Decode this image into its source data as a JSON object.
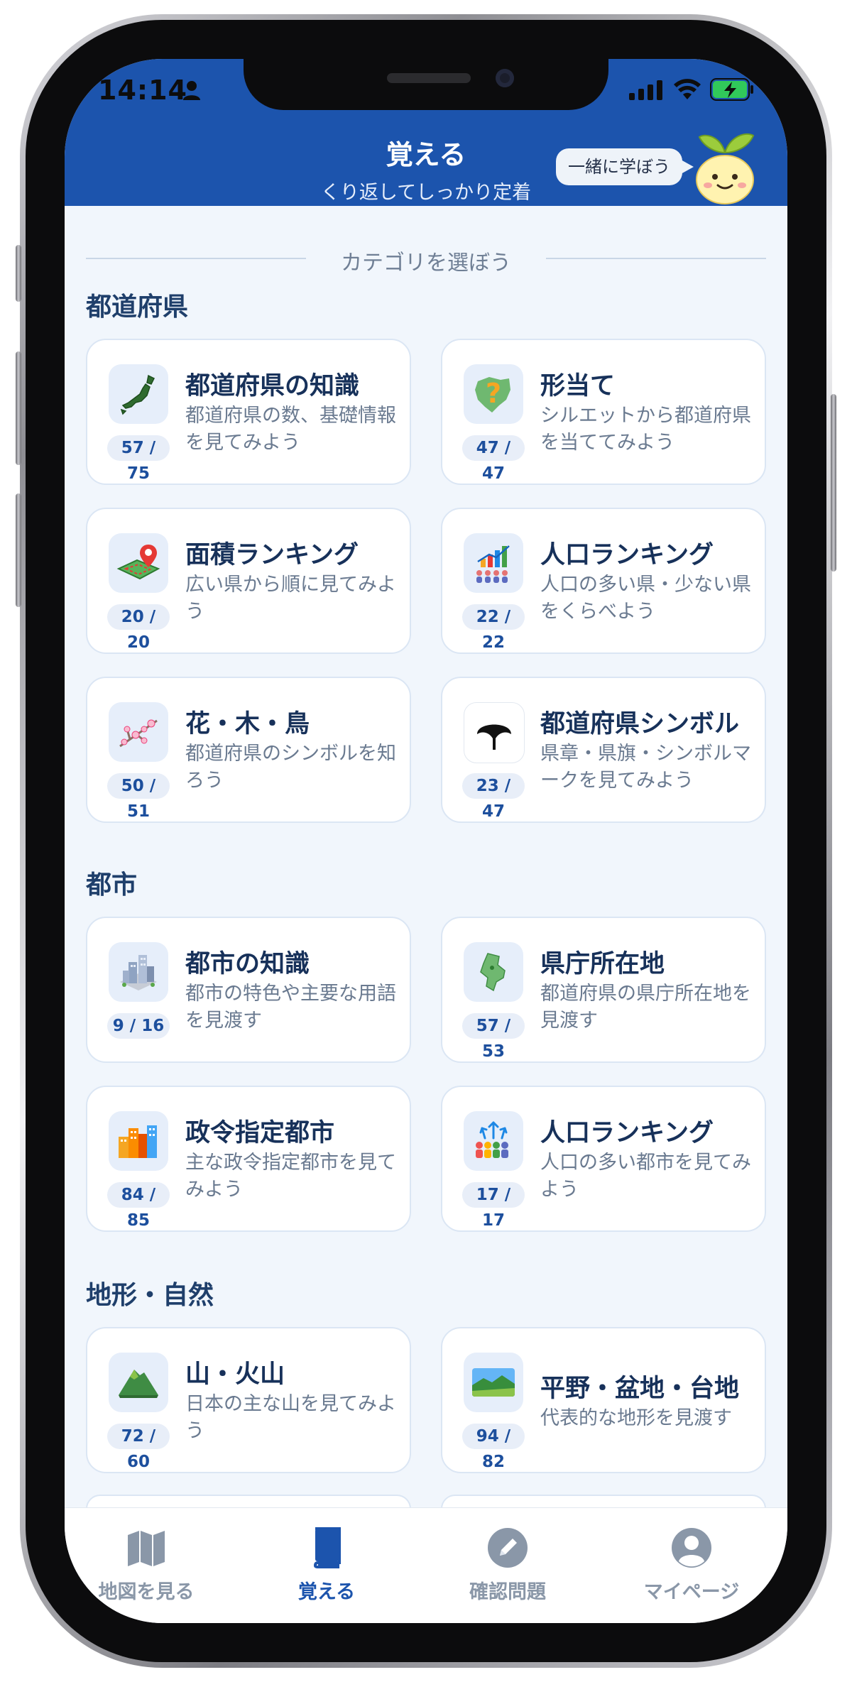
{
  "status_bar": {
    "time": "14:14"
  },
  "header": {
    "title": "覚える",
    "subtitle": "くり返してしっかり定着",
    "bubble": "一緒に学ぼう"
  },
  "divider": "カテゴリを選ぼう",
  "sections": [
    {
      "title": "都道府県"
    },
    {
      "title": "都市"
    },
    {
      "title": "地形・自然"
    }
  ],
  "cards": [
    {
      "title": "都道府県の知識",
      "desc": "都道府県の数、基礎情報を見てみよう",
      "count": "57 / 75",
      "icon": "japan-map-icon"
    },
    {
      "title": "形当て",
      "desc": "シルエットから都道府県を当ててみよう",
      "count": "47 / 47",
      "icon": "silhouette-question-icon"
    },
    {
      "title": "面積ランキング",
      "desc": "広い県から順に見てみよう",
      "count": "20 / 20",
      "icon": "area-pin-map-icon"
    },
    {
      "title": "人口ランキング",
      "desc": "人口の多い県・少ない県をくらべよう",
      "count": "22 / 22",
      "icon": "population-chart-icon"
    },
    {
      "title": "花・木・鳥",
      "desc": "都道府県のシンボルを知ろう",
      "count": "50 / 51",
      "icon": "blossom-branch-icon"
    },
    {
      "title": "都道府県シンボル",
      "desc": "県章・県旗・シンボルマークを見てみよう",
      "count": "23 / 47",
      "icon": "prefecture-emblem-icon"
    },
    {
      "title": "都市の知識",
      "desc": "都市の特色や主要な用語を見渡す",
      "count": "9 / 16",
      "icon": "city-buildings-icon"
    },
    {
      "title": "県庁所在地",
      "desc": "都道府県の県庁所在地を見渡す",
      "count": "57 / 53",
      "icon": "prefecture-map-icon"
    },
    {
      "title": "政令指定都市",
      "desc": "主な政令指定都市を見てみよう",
      "count": "84 / 85",
      "icon": "designated-city-icon"
    },
    {
      "title": "人口ランキング",
      "desc": "人口の多い都市を見てみよう",
      "count": "17 / 17",
      "icon": "city-population-icon"
    },
    {
      "title": "山・火山",
      "desc": "日本の主な山を見てみよう",
      "count": "72 / 60",
      "icon": "mountain-icon"
    },
    {
      "title": "平野・盆地・台地",
      "desc": "代表的な地形を見渡す",
      "count": "94 / 82",
      "icon": "plain-landscape-icon"
    }
  ],
  "tabs": [
    {
      "label": "地図を見る",
      "icon": "map-icon",
      "active": false
    },
    {
      "label": "覚える",
      "icon": "book-icon",
      "active": true
    },
    {
      "label": "確認問題",
      "icon": "pencil-icon",
      "active": false
    },
    {
      "label": "マイページ",
      "icon": "profile-icon",
      "active": false
    }
  ],
  "colors": {
    "header": "#1c54ad",
    "accent": "#1c54ad",
    "background": "#f1f6fc"
  }
}
